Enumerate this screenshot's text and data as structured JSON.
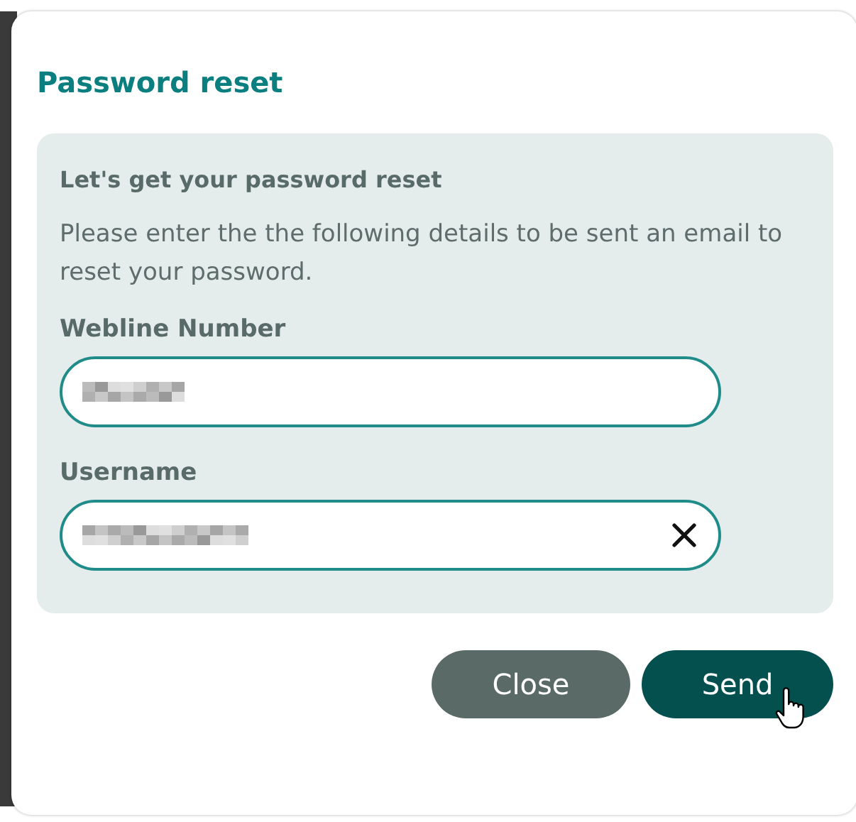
{
  "dialog": {
    "title": "Password reset"
  },
  "panel": {
    "heading": "Let's get your password reset",
    "description": "Please enter the the following details to be sent an email to reset your password."
  },
  "fields": [
    {
      "label": "Webline Number",
      "redacted": true,
      "clear_button": false
    },
    {
      "label": "Username",
      "redacted": true,
      "clear_button": true
    }
  ],
  "buttons": [
    {
      "label": "Close",
      "kind": "secondary",
      "hovered": false
    },
    {
      "label": "Send",
      "kind": "primary",
      "hovered": true
    }
  ]
}
